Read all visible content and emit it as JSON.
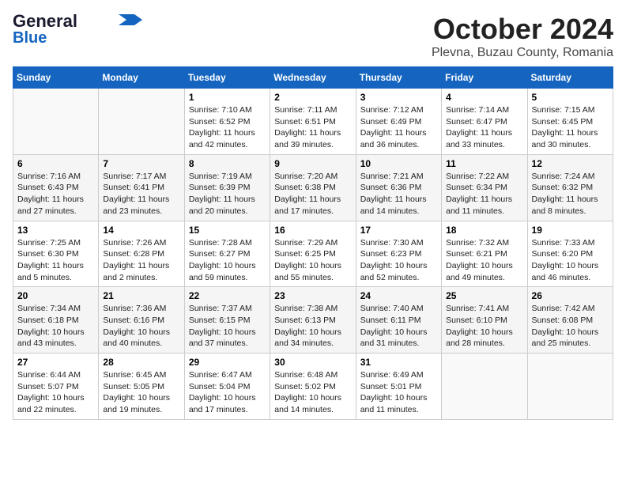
{
  "header": {
    "logo_line1": "General",
    "logo_line2": "Blue",
    "month": "October 2024",
    "location": "Plevna, Buzau County, Romania"
  },
  "weekdays": [
    "Sunday",
    "Monday",
    "Tuesday",
    "Wednesday",
    "Thursday",
    "Friday",
    "Saturday"
  ],
  "weeks": [
    [
      {
        "day": "",
        "content": ""
      },
      {
        "day": "",
        "content": ""
      },
      {
        "day": "1",
        "content": "Sunrise: 7:10 AM\nSunset: 6:52 PM\nDaylight: 11 hours and 42 minutes."
      },
      {
        "day": "2",
        "content": "Sunrise: 7:11 AM\nSunset: 6:51 PM\nDaylight: 11 hours and 39 minutes."
      },
      {
        "day": "3",
        "content": "Sunrise: 7:12 AM\nSunset: 6:49 PM\nDaylight: 11 hours and 36 minutes."
      },
      {
        "day": "4",
        "content": "Sunrise: 7:14 AM\nSunset: 6:47 PM\nDaylight: 11 hours and 33 minutes."
      },
      {
        "day": "5",
        "content": "Sunrise: 7:15 AM\nSunset: 6:45 PM\nDaylight: 11 hours and 30 minutes."
      }
    ],
    [
      {
        "day": "6",
        "content": "Sunrise: 7:16 AM\nSunset: 6:43 PM\nDaylight: 11 hours and 27 minutes."
      },
      {
        "day": "7",
        "content": "Sunrise: 7:17 AM\nSunset: 6:41 PM\nDaylight: 11 hours and 23 minutes."
      },
      {
        "day": "8",
        "content": "Sunrise: 7:19 AM\nSunset: 6:39 PM\nDaylight: 11 hours and 20 minutes."
      },
      {
        "day": "9",
        "content": "Sunrise: 7:20 AM\nSunset: 6:38 PM\nDaylight: 11 hours and 17 minutes."
      },
      {
        "day": "10",
        "content": "Sunrise: 7:21 AM\nSunset: 6:36 PM\nDaylight: 11 hours and 14 minutes."
      },
      {
        "day": "11",
        "content": "Sunrise: 7:22 AM\nSunset: 6:34 PM\nDaylight: 11 hours and 11 minutes."
      },
      {
        "day": "12",
        "content": "Sunrise: 7:24 AM\nSunset: 6:32 PM\nDaylight: 11 hours and 8 minutes."
      }
    ],
    [
      {
        "day": "13",
        "content": "Sunrise: 7:25 AM\nSunset: 6:30 PM\nDaylight: 11 hours and 5 minutes."
      },
      {
        "day": "14",
        "content": "Sunrise: 7:26 AM\nSunset: 6:28 PM\nDaylight: 11 hours and 2 minutes."
      },
      {
        "day": "15",
        "content": "Sunrise: 7:28 AM\nSunset: 6:27 PM\nDaylight: 10 hours and 59 minutes."
      },
      {
        "day": "16",
        "content": "Sunrise: 7:29 AM\nSunset: 6:25 PM\nDaylight: 10 hours and 55 minutes."
      },
      {
        "day": "17",
        "content": "Sunrise: 7:30 AM\nSunset: 6:23 PM\nDaylight: 10 hours and 52 minutes."
      },
      {
        "day": "18",
        "content": "Sunrise: 7:32 AM\nSunset: 6:21 PM\nDaylight: 10 hours and 49 minutes."
      },
      {
        "day": "19",
        "content": "Sunrise: 7:33 AM\nSunset: 6:20 PM\nDaylight: 10 hours and 46 minutes."
      }
    ],
    [
      {
        "day": "20",
        "content": "Sunrise: 7:34 AM\nSunset: 6:18 PM\nDaylight: 10 hours and 43 minutes."
      },
      {
        "day": "21",
        "content": "Sunrise: 7:36 AM\nSunset: 6:16 PM\nDaylight: 10 hours and 40 minutes."
      },
      {
        "day": "22",
        "content": "Sunrise: 7:37 AM\nSunset: 6:15 PM\nDaylight: 10 hours and 37 minutes."
      },
      {
        "day": "23",
        "content": "Sunrise: 7:38 AM\nSunset: 6:13 PM\nDaylight: 10 hours and 34 minutes."
      },
      {
        "day": "24",
        "content": "Sunrise: 7:40 AM\nSunset: 6:11 PM\nDaylight: 10 hours and 31 minutes."
      },
      {
        "day": "25",
        "content": "Sunrise: 7:41 AM\nSunset: 6:10 PM\nDaylight: 10 hours and 28 minutes."
      },
      {
        "day": "26",
        "content": "Sunrise: 7:42 AM\nSunset: 6:08 PM\nDaylight: 10 hours and 25 minutes."
      }
    ],
    [
      {
        "day": "27",
        "content": "Sunrise: 6:44 AM\nSunset: 5:07 PM\nDaylight: 10 hours and 22 minutes."
      },
      {
        "day": "28",
        "content": "Sunrise: 6:45 AM\nSunset: 5:05 PM\nDaylight: 10 hours and 19 minutes."
      },
      {
        "day": "29",
        "content": "Sunrise: 6:47 AM\nSunset: 5:04 PM\nDaylight: 10 hours and 17 minutes."
      },
      {
        "day": "30",
        "content": "Sunrise: 6:48 AM\nSunset: 5:02 PM\nDaylight: 10 hours and 14 minutes."
      },
      {
        "day": "31",
        "content": "Sunrise: 6:49 AM\nSunset: 5:01 PM\nDaylight: 10 hours and 11 minutes."
      },
      {
        "day": "",
        "content": ""
      },
      {
        "day": "",
        "content": ""
      }
    ]
  ]
}
